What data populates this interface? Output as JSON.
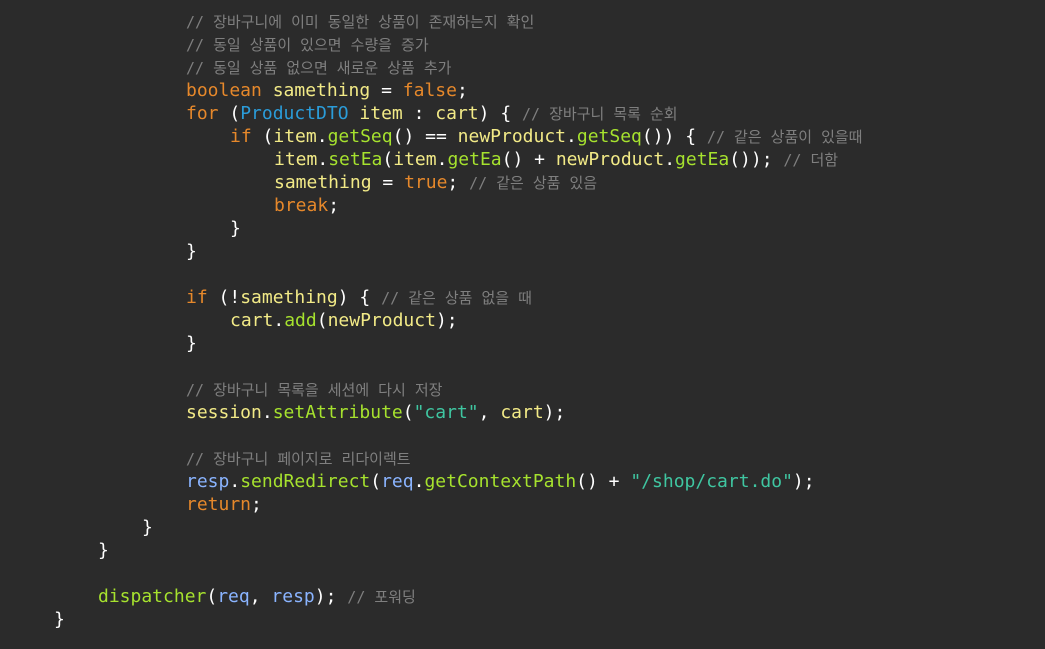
{
  "editor": {
    "background": "#2b2b2b",
    "theme_colors": {
      "keyword": "#e6882b",
      "type": "#2b9cd9",
      "variable": "#f2ea87",
      "function": "#a6e22e",
      "string": "#3fc6a1",
      "comment": "#7f7f7f",
      "identifier": "#8ab4ff"
    },
    "lines": [
      {
        "indent": 12,
        "tokens": [
          {
            "k": "cm",
            "t": "// 장바구니에 이미 동일한 상품이 존재하는지 확인"
          }
        ]
      },
      {
        "indent": 12,
        "tokens": [
          {
            "k": "cm",
            "t": "// 동일 상품이 있으면 수량을 증가"
          }
        ]
      },
      {
        "indent": 12,
        "tokens": [
          {
            "k": "cm",
            "t": "// 동일 상품 없으면 새로운 상품 추가"
          }
        ]
      },
      {
        "indent": 12,
        "tokens": [
          {
            "k": "kw",
            "t": "boolean"
          },
          {
            "k": "plain",
            "t": " "
          },
          {
            "k": "var",
            "t": "samething"
          },
          {
            "k": "plain",
            "t": " = "
          },
          {
            "k": "kw",
            "t": "false"
          },
          {
            "k": "plain",
            "t": ";"
          }
        ]
      },
      {
        "indent": 12,
        "tokens": [
          {
            "k": "kw",
            "t": "for"
          },
          {
            "k": "plain",
            "t": " ("
          },
          {
            "k": "type",
            "t": "ProductDTO"
          },
          {
            "k": "plain",
            "t": " "
          },
          {
            "k": "var",
            "t": "item"
          },
          {
            "k": "plain",
            "t": " : "
          },
          {
            "k": "var",
            "t": "cart"
          },
          {
            "k": "plain",
            "t": ") { "
          },
          {
            "k": "cm",
            "t": "// 장바구니 목록 순회"
          }
        ]
      },
      {
        "indent": 16,
        "tokens": [
          {
            "k": "kw",
            "t": "if"
          },
          {
            "k": "plain",
            "t": " ("
          },
          {
            "k": "var",
            "t": "item"
          },
          {
            "k": "plain",
            "t": "."
          },
          {
            "k": "fn",
            "t": "getSeq"
          },
          {
            "k": "plain",
            "t": "() == "
          },
          {
            "k": "var",
            "t": "newProduct"
          },
          {
            "k": "plain",
            "t": "."
          },
          {
            "k": "fn",
            "t": "getSeq"
          },
          {
            "k": "plain",
            "t": "()) { "
          },
          {
            "k": "cm",
            "t": "// 같은 상품이 있을때"
          }
        ]
      },
      {
        "indent": 20,
        "tokens": [
          {
            "k": "var",
            "t": "item"
          },
          {
            "k": "plain",
            "t": "."
          },
          {
            "k": "fn",
            "t": "setEa"
          },
          {
            "k": "plain",
            "t": "("
          },
          {
            "k": "var",
            "t": "item"
          },
          {
            "k": "plain",
            "t": "."
          },
          {
            "k": "fn",
            "t": "getEa"
          },
          {
            "k": "plain",
            "t": "() + "
          },
          {
            "k": "var",
            "t": "newProduct"
          },
          {
            "k": "plain",
            "t": "."
          },
          {
            "k": "fn",
            "t": "getEa"
          },
          {
            "k": "plain",
            "t": "()); "
          },
          {
            "k": "cm",
            "t": "// 더함"
          }
        ]
      },
      {
        "indent": 20,
        "tokens": [
          {
            "k": "var",
            "t": "samething"
          },
          {
            "k": "plain",
            "t": " = "
          },
          {
            "k": "kw",
            "t": "true"
          },
          {
            "k": "plain",
            "t": "; "
          },
          {
            "k": "cm",
            "t": "// 같은 상품 있음"
          }
        ]
      },
      {
        "indent": 20,
        "tokens": [
          {
            "k": "kw",
            "t": "break"
          },
          {
            "k": "plain",
            "t": ";"
          }
        ]
      },
      {
        "indent": 16,
        "tokens": [
          {
            "k": "plain",
            "t": "}"
          }
        ]
      },
      {
        "indent": 12,
        "tokens": [
          {
            "k": "plain",
            "t": "}"
          }
        ]
      },
      {
        "indent": 0,
        "tokens": []
      },
      {
        "indent": 12,
        "tokens": [
          {
            "k": "kw",
            "t": "if"
          },
          {
            "k": "plain",
            "t": " (!"
          },
          {
            "k": "var",
            "t": "samething"
          },
          {
            "k": "plain",
            "t": ") { "
          },
          {
            "k": "cm",
            "t": "// 같은 상품 없을 때"
          }
        ]
      },
      {
        "indent": 16,
        "tokens": [
          {
            "k": "var",
            "t": "cart"
          },
          {
            "k": "plain",
            "t": "."
          },
          {
            "k": "fn",
            "t": "add"
          },
          {
            "k": "plain",
            "t": "("
          },
          {
            "k": "var",
            "t": "newProduct"
          },
          {
            "k": "plain",
            "t": ");"
          }
        ]
      },
      {
        "indent": 12,
        "tokens": [
          {
            "k": "plain",
            "t": "}"
          }
        ]
      },
      {
        "indent": 0,
        "tokens": []
      },
      {
        "indent": 12,
        "tokens": [
          {
            "k": "cm",
            "t": "// 장바구니 목록을 세션에 다시 저장"
          }
        ]
      },
      {
        "indent": 12,
        "tokens": [
          {
            "k": "var",
            "t": "session"
          },
          {
            "k": "plain",
            "t": "."
          },
          {
            "k": "fn",
            "t": "setAttribute"
          },
          {
            "k": "plain",
            "t": "("
          },
          {
            "k": "str",
            "t": "\"cart\""
          },
          {
            "k": "plain",
            "t": ", "
          },
          {
            "k": "var",
            "t": "cart"
          },
          {
            "k": "plain",
            "t": ");"
          }
        ]
      },
      {
        "indent": 0,
        "tokens": []
      },
      {
        "indent": 12,
        "tokens": [
          {
            "k": "cm",
            "t": "// 장바구니 페이지로 리다이렉트"
          }
        ]
      },
      {
        "indent": 12,
        "tokens": [
          {
            "k": "id",
            "t": "resp"
          },
          {
            "k": "plain",
            "t": "."
          },
          {
            "k": "fn",
            "t": "sendRedirect"
          },
          {
            "k": "plain",
            "t": "("
          },
          {
            "k": "id",
            "t": "req"
          },
          {
            "k": "plain",
            "t": "."
          },
          {
            "k": "fn",
            "t": "getContextPath"
          },
          {
            "k": "plain",
            "t": "() + "
          },
          {
            "k": "str",
            "t": "\"/shop/cart.do\""
          },
          {
            "k": "plain",
            "t": ");"
          }
        ]
      },
      {
        "indent": 12,
        "tokens": [
          {
            "k": "kw",
            "t": "return"
          },
          {
            "k": "plain",
            "t": ";"
          }
        ]
      },
      {
        "indent": 8,
        "tokens": [
          {
            "k": "plain",
            "t": "}"
          }
        ]
      },
      {
        "indent": 4,
        "tokens": [
          {
            "k": "plain",
            "t": "}"
          }
        ]
      },
      {
        "indent": 0,
        "tokens": []
      },
      {
        "indent": 4,
        "tokens": [
          {
            "k": "fn",
            "t": "dispatcher"
          },
          {
            "k": "plain",
            "t": "("
          },
          {
            "k": "id",
            "t": "req"
          },
          {
            "k": "plain",
            "t": ", "
          },
          {
            "k": "id",
            "t": "resp"
          },
          {
            "k": "plain",
            "t": "); "
          },
          {
            "k": "cm",
            "t": "// 포워딩"
          }
        ]
      },
      {
        "indent": 0,
        "tokens": [
          {
            "k": "plain",
            "t": "}"
          }
        ]
      }
    ]
  }
}
